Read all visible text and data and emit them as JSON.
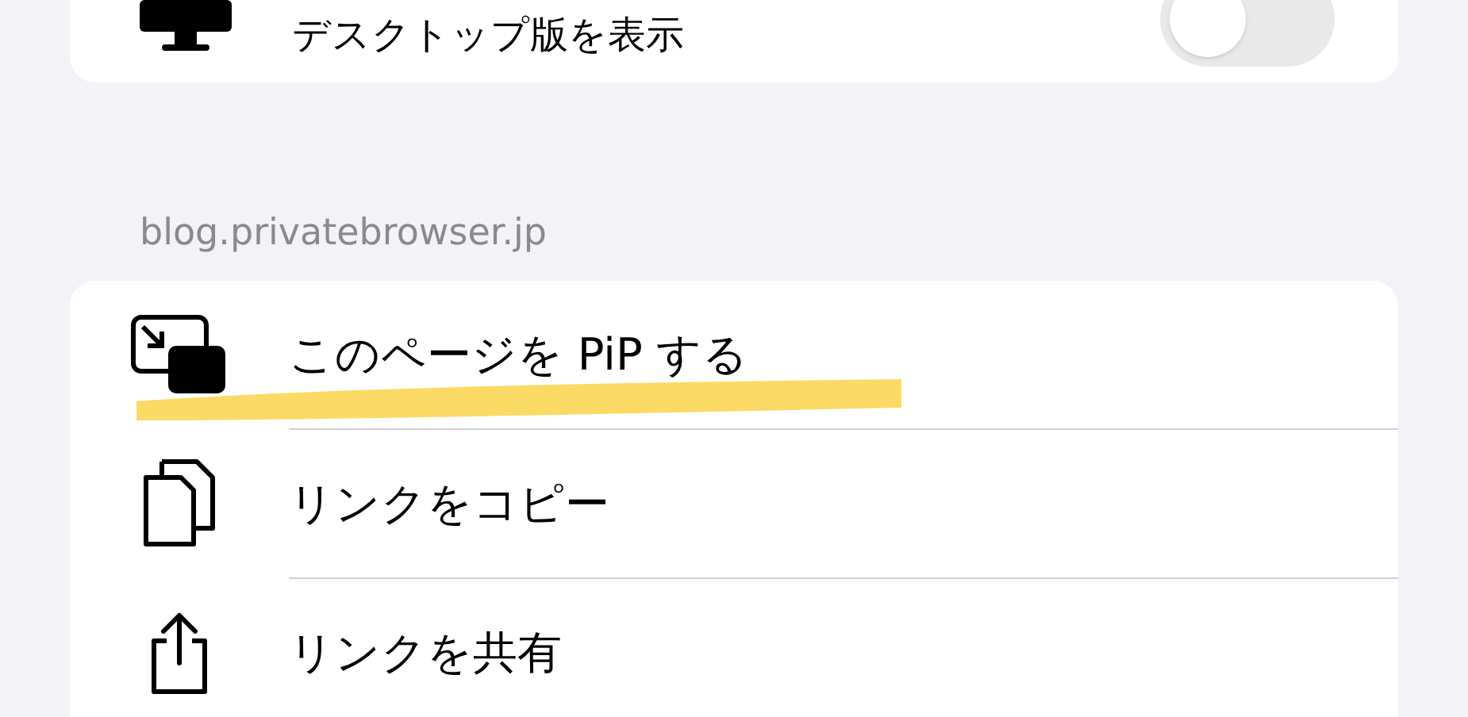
{
  "top_card": {
    "label": "デスクトップ版を表示",
    "toggle": {
      "on": false
    }
  },
  "section_header": "blog.privatebrowser.jp",
  "actions": [
    {
      "kind": "pip",
      "label": "このページを PiP する",
      "highlighted": true
    },
    {
      "kind": "copy",
      "label": "リンクをコピー",
      "highlighted": false
    },
    {
      "kind": "share",
      "label": "リンクを共有",
      "highlighted": false
    }
  ]
}
